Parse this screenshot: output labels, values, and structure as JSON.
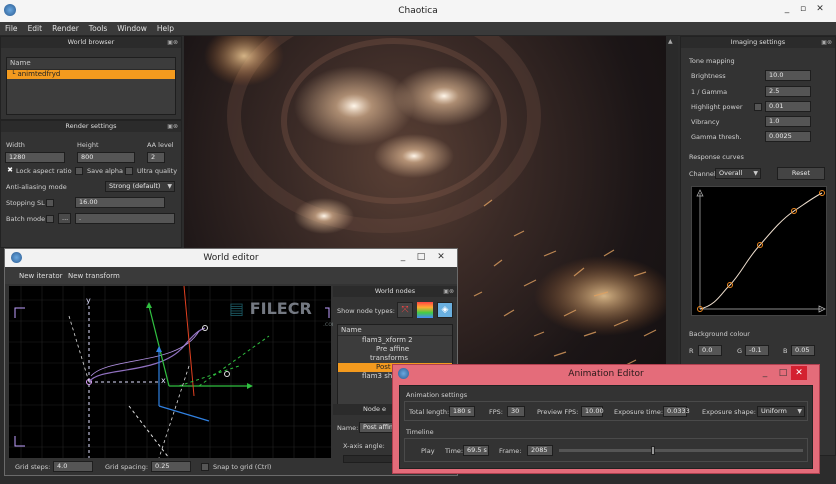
{
  "app": {
    "title": "Chaotica"
  },
  "menu": [
    "File",
    "Edit",
    "Render",
    "Tools",
    "Window",
    "Help"
  ],
  "world_browser": {
    "title": "World browser",
    "column": "Name",
    "items": [
      "animtedfryd"
    ]
  },
  "render_settings": {
    "title": "Render settings",
    "width_label": "Width",
    "height_label": "Height",
    "aa_label": "AA level",
    "width": "1280",
    "height": "800",
    "aa": "2",
    "lock_aspect": "Lock aspect ratio",
    "save_alpha": "Save alpha",
    "ultra_quality": "Ultra quality",
    "aa_mode_label": "Anti-aliasing mode",
    "aa_mode": "Strong (default)",
    "stopping_label": "Stopping SL",
    "stopping": "16.00",
    "batch_label": "Batch mode",
    "batch_btn": "...",
    "batch_value": "."
  },
  "imaging": {
    "title": "Imaging settings",
    "tone_mapping": "Tone mapping",
    "rows": [
      {
        "label": "Brightness",
        "value": "10.0"
      },
      {
        "label": "1 / Gamma",
        "value": "2.5"
      },
      {
        "label": "Highlight power",
        "value": "0.01"
      },
      {
        "label": "Vibrancy",
        "value": "1.0"
      },
      {
        "label": "Gamma thresh.",
        "value": "0.0025"
      }
    ],
    "response_curves": "Response curves",
    "channel_label": "Channel:",
    "channel": "Overall",
    "reset": "Reset",
    "bg_colour": "Background colour",
    "r_label": "R",
    "r": "0.0",
    "g_label": "G",
    "g": "-0.1",
    "b_label": "B",
    "b": "0.05"
  },
  "world_editor": {
    "title": "World editor",
    "toolbar": [
      "New iterator",
      "New transform"
    ],
    "nodes_title": "World nodes",
    "show_node_types": "Show node types:",
    "column": "Name",
    "tree": [
      "flam3_xform 2",
      "Pre affine",
      "transforms",
      "Post",
      "flam3 sh"
    ],
    "node_title": "Node e",
    "name_label": "Name:",
    "name_value": "Post affine",
    "xaxis_label": "X-axis angle:",
    "axis_y": "y",
    "axis_x": "x",
    "grid_steps_label": "Grid steps:",
    "grid_steps": "4.0",
    "grid_spacing_label": "Grid spacing:",
    "grid_spacing": "0.25",
    "snap": "Snap to grid (Ctrl)"
  },
  "watermark": {
    "text": "FILECR",
    "sub": ".com"
  },
  "anim_editor": {
    "title": "Animation Editor",
    "settings_title": "Animation settings",
    "total_length_label": "Total length:",
    "total_length": "180 s",
    "fps_label": "FPS:",
    "fps": "30",
    "preview_fps_label": "Preview FPS:",
    "preview_fps": "10.00",
    "exposure_label": "Exposure time:",
    "exposure": "0.0333",
    "shape_label": "Exposure shape:",
    "shape": "Uniform",
    "timeline_title": "Timeline",
    "play": "Play",
    "time_label": "Time:",
    "time": "69.5 s",
    "frame_label": "Frame:",
    "frame": "2085",
    "progress": 0.386
  }
}
